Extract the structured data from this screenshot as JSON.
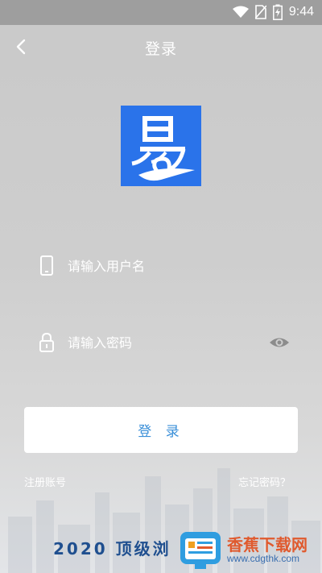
{
  "status_bar": {
    "time": "9:44",
    "icons": [
      "wifi-icon",
      "no-sim-icon",
      "battery-charging-icon"
    ]
  },
  "header": {
    "title": "登录",
    "back_icon": "chevron-left-icon"
  },
  "logo": {
    "glyph": "易",
    "color": "#2a73ea"
  },
  "form": {
    "username": {
      "placeholder": "请输入用户名",
      "value": "",
      "icon": "phone-icon"
    },
    "password": {
      "placeholder": "请输入密码",
      "value": "",
      "icon": "lock-icon",
      "toggle_icon": "eye-icon"
    },
    "submit_label": "登 录"
  },
  "links": {
    "register": "注册账号",
    "forgot": "忘记密码？"
  },
  "footer": {
    "slogan": "2020 顶级浏",
    "watermark_title": "香蕉下载网",
    "watermark_url": "www.cdgthk.com"
  },
  "colors": {
    "accent_text": "#3a8fd8",
    "status_bar": "#9e9e9e",
    "background": "#cfcfcf"
  }
}
